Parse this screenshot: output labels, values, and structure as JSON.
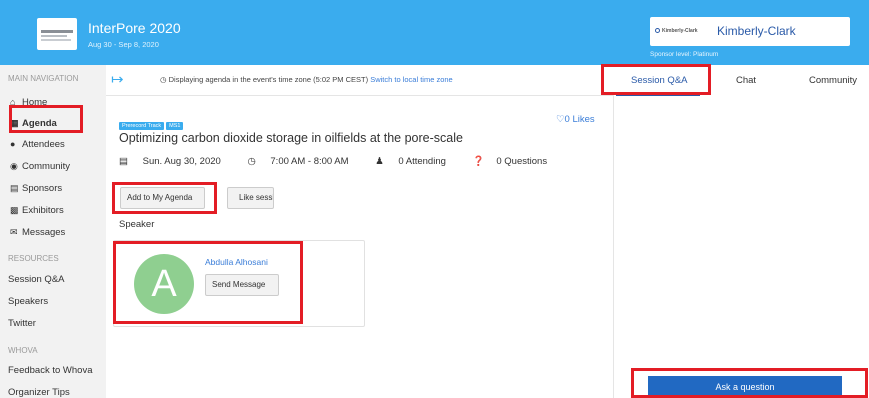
{
  "event": {
    "title": "InterPore 2020",
    "dates": "Aug 30 - Sep 8, 2020"
  },
  "sponsor": {
    "logo_text": "Kimberly-Clark",
    "name": "Kimberly-Clark",
    "level": "Sponsor level: Platinum"
  },
  "sidebar": {
    "main_nav_label": "MAIN NAVIGATION",
    "items": [
      {
        "label": "Home",
        "icon": "home-icon"
      },
      {
        "label": "Agenda",
        "icon": "calendar-icon"
      },
      {
        "label": "Attendees",
        "icon": "users-icon"
      },
      {
        "label": "Community",
        "icon": "chat-icon"
      },
      {
        "label": "Sponsors",
        "icon": "sponsors-icon"
      },
      {
        "label": "Exhibitors",
        "icon": "building-icon"
      },
      {
        "label": "Messages",
        "icon": "envelope-icon"
      }
    ],
    "resources_label": "RESOURCES",
    "resources": [
      "Session Q&A",
      "Speakers",
      "Twitter"
    ],
    "whova_label": "WHOVA",
    "whova": [
      "Feedback to Whova",
      "Organizer Tips"
    ]
  },
  "topbar": {
    "timezone_text": "Displaying agenda in the event's time zone (5:02 PM CEST)",
    "switch_link": "Switch to local time zone"
  },
  "tabs": {
    "qa": "Session Q&A",
    "chat": "Chat",
    "community": "Community"
  },
  "session": {
    "tags": [
      "Prerecord Track",
      "MS1"
    ],
    "likes": "0 Likes",
    "title": "Optimizing carbon dioxide storage in oilfields at the pore-scale",
    "date": "Sun. Aug 30, 2020",
    "time": "7:00 AM - 8:00 AM",
    "attending": "0 Attending",
    "questions": "0 Questions",
    "add_to_agenda": "Add to My Agenda",
    "like_session": "Like session",
    "speaker_label": "Speaker"
  },
  "speaker": {
    "initial": "A",
    "name": "Abdulla Alhosani",
    "send_message": "Send Message"
  },
  "qa_panel": {
    "ask_button": "Ask a question"
  },
  "colors": {
    "header": "#3aacee",
    "link": "#3a7dd8",
    "primary_button": "#2169c2",
    "highlight": "#e31d25",
    "avatar": "#8fcf90"
  }
}
